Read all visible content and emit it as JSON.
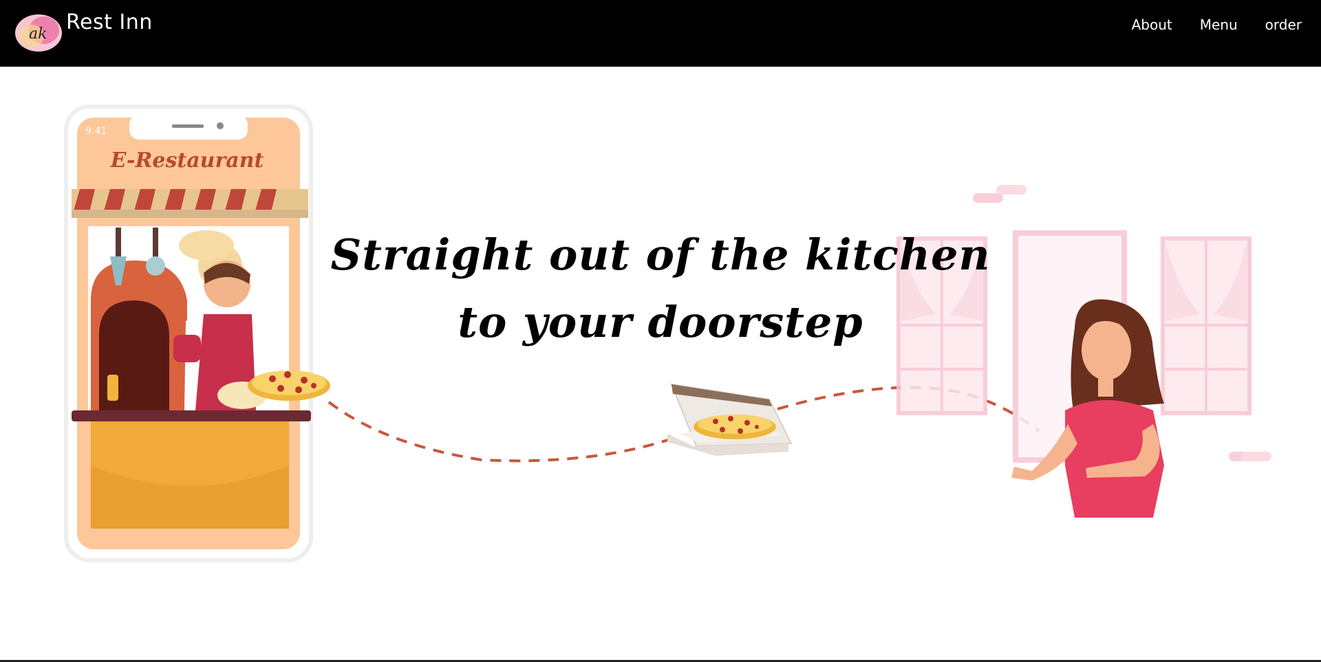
{
  "app": {
    "brand": "Rest Inn",
    "logo_text": "ak"
  },
  "nav": {
    "items": [
      {
        "label": "About"
      },
      {
        "label": "Menu"
      },
      {
        "label": "order"
      }
    ]
  },
  "hero": {
    "headline": "Straight out of the kitchen to your doorstep",
    "phone_title": "E-Restaurant",
    "phone_time": "9:41"
  },
  "colors": {
    "nav_bg": "#000000",
    "accent_red": "#c2373f",
    "pink": "#e83e5f",
    "orange": "#f0a93a"
  }
}
